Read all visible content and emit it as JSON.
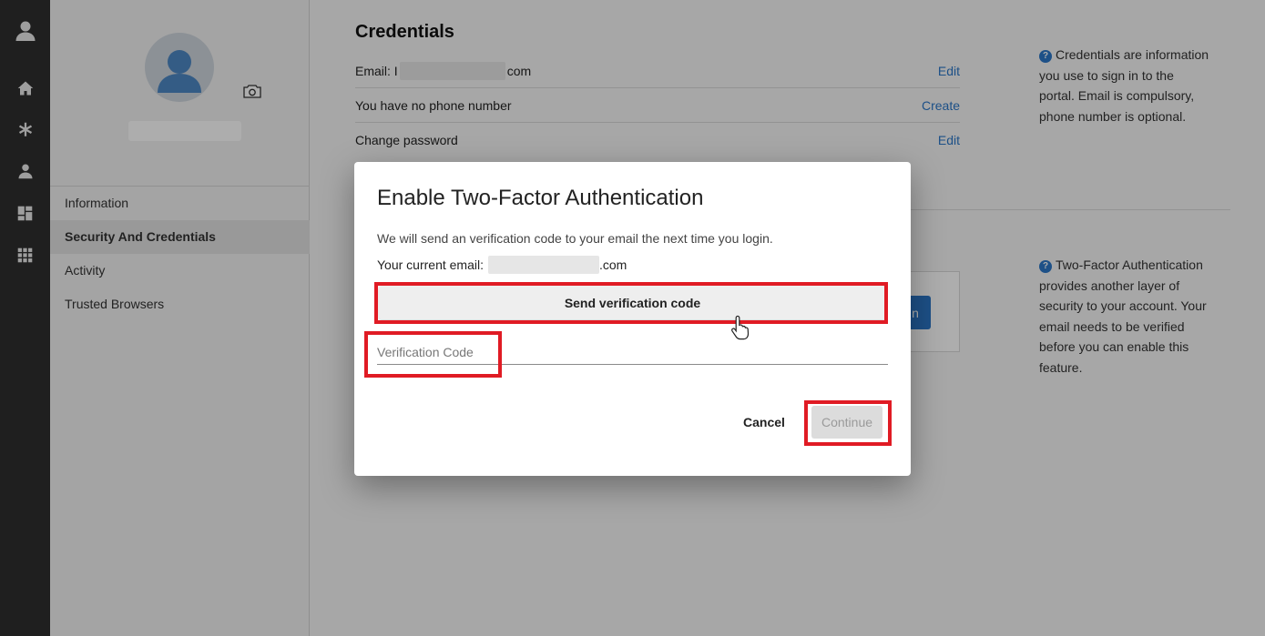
{
  "rail": {
    "icons": [
      "user-icon",
      "home-icon",
      "asterisk-icon",
      "person-icon",
      "dashboard-icon",
      "apps-grid-icon"
    ]
  },
  "profile": {
    "nav_items": [
      {
        "label": "Information"
      },
      {
        "label": "Security And Credentials",
        "active": true
      },
      {
        "label": "Activity"
      },
      {
        "label": "Trusted Browsers"
      }
    ]
  },
  "credentials": {
    "title": "Credentials",
    "email_prefix": "Email: I",
    "email_suffix": "com",
    "email_action": "Edit",
    "phone_text": "You have no phone number",
    "phone_action": "Create",
    "password_text": "Change password",
    "password_action": "Edit",
    "help_text": "Credentials are information you use to sign in to the portal. Email is compulsory, phone number is optional."
  },
  "two_factor": {
    "help_text": "Two-Factor Authentication provides another layer of security to your account. Your email needs to be verified before you can enable this feature.",
    "button_partial_label": "n"
  },
  "modal": {
    "title": "Enable Two-Factor Authentication",
    "description": "We will send an verification code to your email the next time you login.",
    "email_label": "Your current email:",
    "email_suffix": ".com",
    "send_button": "Send verification code",
    "code_placeholder": "Verification Code",
    "cancel_button": "Cancel",
    "continue_button": "Continue"
  },
  "colors": {
    "accent": "#2b77c8",
    "highlight": "#e01b24",
    "rail": "#2f2f2f"
  }
}
